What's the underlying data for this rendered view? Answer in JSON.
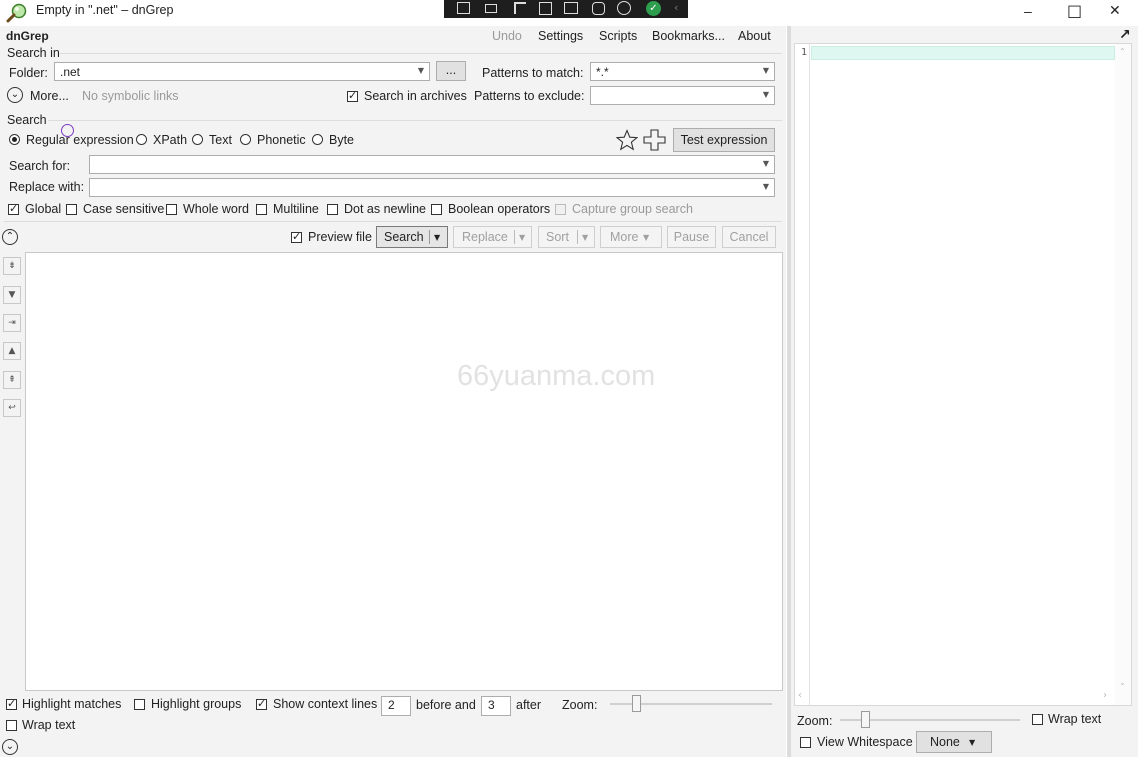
{
  "window": {
    "title": "Empty in \".net\" – dnGrep",
    "minimize": "–",
    "maximize": "□",
    "close": "✕"
  },
  "menu": {
    "app_name": "dnGrep",
    "undo": "Undo",
    "settings": "Settings",
    "scripts": "Scripts",
    "bookmarks": "Bookmarks...",
    "about": "About"
  },
  "search_in": {
    "group_label": "Search in",
    "folder_label": "Folder:",
    "folder_value": ".net",
    "browse_label": "...",
    "patterns_match_label": "Patterns to match:",
    "patterns_match_value": "*.*",
    "patterns_exclude_label": "Patterns to exclude:",
    "patterns_exclude_value": "",
    "more_label": "More...",
    "symlinks_label": "No symbolic links",
    "search_archives_label": "Search in archives",
    "search_archives_checked": true
  },
  "search": {
    "group_label": "Search",
    "types": [
      {
        "label": "Regular expression",
        "checked": true
      },
      {
        "label": "XPath",
        "checked": false
      },
      {
        "label": "Text",
        "checked": false
      },
      {
        "label": "Phonetic",
        "checked": false
      },
      {
        "label": "Byte",
        "checked": false
      }
    ],
    "test_expression_label": "Test expression",
    "search_for_label": "Search for:",
    "search_for_value": "",
    "replace_with_label": "Replace with:",
    "replace_with_value": "",
    "options": [
      {
        "label": "Global",
        "checked": true,
        "disabled": false
      },
      {
        "label": "Case sensitive",
        "checked": false,
        "disabled": false
      },
      {
        "label": "Whole word",
        "checked": false,
        "disabled": false
      },
      {
        "label": "Multiline",
        "checked": false,
        "disabled": false
      },
      {
        "label": "Dot as newline",
        "checked": false,
        "disabled": false
      },
      {
        "label": "Boolean operators",
        "checked": false,
        "disabled": false
      },
      {
        "label": "Capture group search",
        "checked": false,
        "disabled": true
      }
    ]
  },
  "toolbar": {
    "preview_file_label": "Preview file",
    "preview_file_checked": true,
    "search_label": "Search",
    "replace_label": "Replace",
    "sort_label": "Sort",
    "more_label": "More",
    "pause_label": "Pause",
    "cancel_label": "Cancel"
  },
  "results": {
    "watermark": "66yuanma.com"
  },
  "bottom": {
    "highlight_matches_label": "Highlight matches",
    "highlight_matches_checked": true,
    "highlight_groups_label": "Highlight groups",
    "highlight_groups_checked": false,
    "show_context_label": "Show context lines",
    "show_context_checked": true,
    "before_value": "2",
    "before_and_label": "before and",
    "after_value": "3",
    "after_label": "after",
    "zoom_label": "Zoom:",
    "wrap_text_label": "Wrap text",
    "wrap_text_checked": false
  },
  "preview": {
    "line_number": "1",
    "zoom_label": "Zoom:",
    "wrap_text_label": "Wrap text",
    "wrap_text_checked": false,
    "view_whitespace_label": "View Whitespace",
    "view_whitespace_checked": false,
    "syntax_value": "None"
  },
  "colors": {
    "current_line": "#dff7f1",
    "accent": "#2e9d4e"
  }
}
